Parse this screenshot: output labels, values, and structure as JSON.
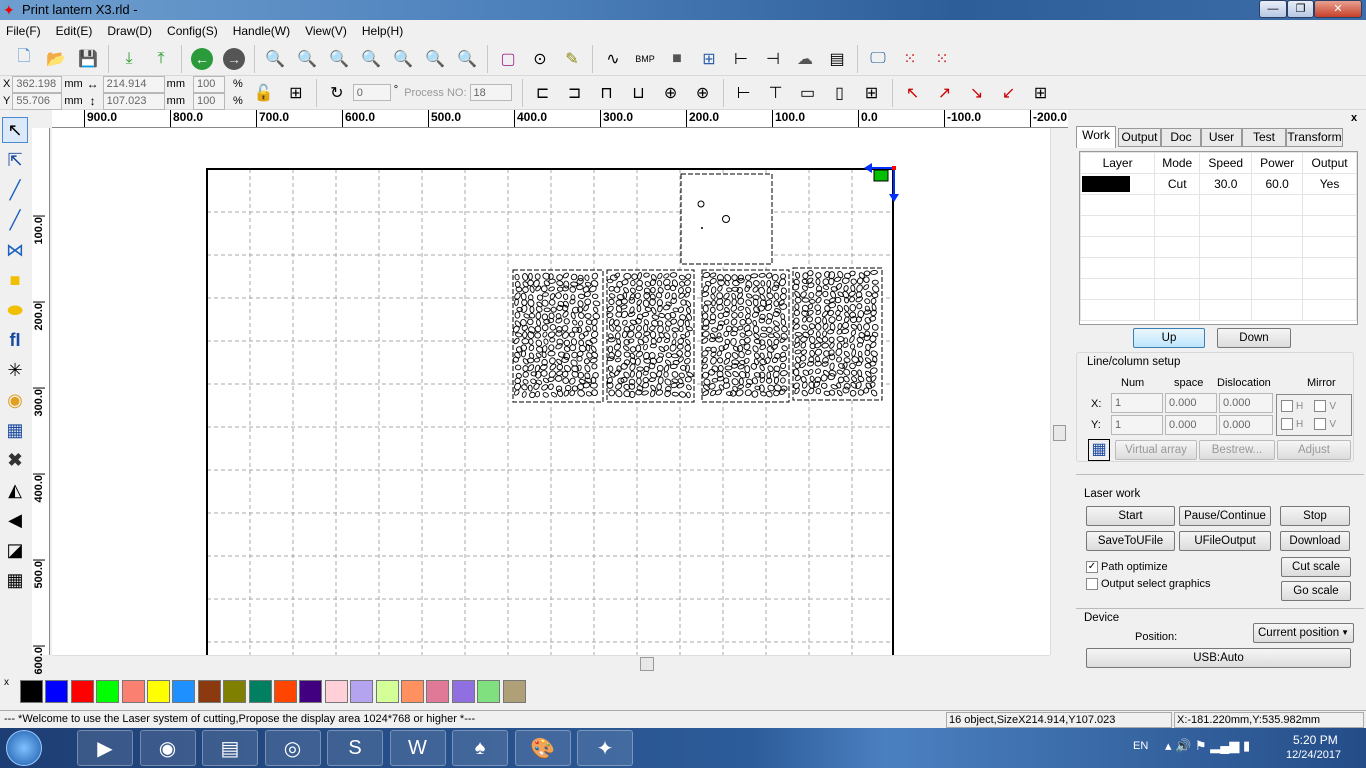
{
  "window": {
    "title": "Print lantern X3.rld -",
    "min": "—",
    "max": "❐",
    "close": "✕"
  },
  "menu": [
    "File(F)",
    "Edit(E)",
    "Draw(D)",
    "Config(S)",
    "Handle(W)",
    "View(V)",
    "Help(H)"
  ],
  "toolbar1": [
    "new-file",
    "open-folder",
    "save",
    "import",
    "export",
    "undo",
    "redo",
    "zoom-pan",
    "zoom-in",
    "zoom-out",
    "zoom-page",
    "zoom-select",
    "zoom-all",
    "zoom-fit",
    "select-rect",
    "node-edit",
    "magic",
    "polyline",
    "bmp",
    "fill-square",
    "group",
    "align-h",
    "align-v",
    "laser",
    "doc",
    "monitor",
    "grid-1",
    "grid-2"
  ],
  "coords": {
    "x_label": "X",
    "y_label": "Y",
    "x": "362.198",
    "y": "55.706",
    "w": "214.914",
    "h": "107.023",
    "unit": "mm",
    "sx": "100",
    "sy": "100",
    "pct": "%",
    "rotate": "0",
    "deg": "°",
    "process_label": "Process NO:",
    "process_no": "18"
  },
  "ruler": {
    "top": [
      "900.0",
      "800.0",
      "700.0",
      "600.0",
      "500.0",
      "400.0",
      "300.0",
      "200.0",
      "100.0",
      "0.0",
      "-100.0",
      "-200.0"
    ],
    "left": [
      "100.0",
      "200.0",
      "300.0",
      "400.0",
      "500.0",
      "600.0"
    ]
  },
  "palette": [
    "#000000",
    "#0000ff",
    "#ff0000",
    "#00ff00",
    "#fa8072",
    "#ffff00",
    "#1e90ff",
    "#8b3a10",
    "#808000",
    "#008060",
    "#ff4500",
    "#400080",
    "#ffd0d8",
    "#b4a4f0",
    "#d4ff98",
    "#ff9060",
    "#e07898",
    "#9070e0",
    "#80e080",
    "#b0a078"
  ],
  "palette_close": "x",
  "status": {
    "message": "--- *Welcome to use the Laser system of cutting,Propose the display area 1024*768 or higher *---",
    "objects": "16 object,SizeX214.914,Y107.023",
    "position": "X:-181.220mm,Y:535.982mm"
  },
  "panel": {
    "close": "x",
    "tabs": [
      "Work",
      "Output",
      "Doc",
      "User",
      "Test",
      "Transform"
    ],
    "layer_headers": [
      "Layer",
      "Mode",
      "Speed",
      "Power",
      "Output"
    ],
    "layers": [
      {
        "color": "#000000",
        "mode": "Cut",
        "speed": "30.0",
        "power": "60.0",
        "output": "Yes"
      }
    ],
    "up": "Up",
    "down": "Down",
    "lc": {
      "title": "Line/column setup",
      "num": "Num",
      "space": "space",
      "dislocation": "Dislocation",
      "mirror": "Mirror",
      "x_label": "X:",
      "y_label": "Y:",
      "x_num": "1",
      "x_space": "0.000",
      "x_disl": "0.000",
      "y_num": "1",
      "y_space": "0.000",
      "y_disl": "0.000",
      "h": "H",
      "v": "V",
      "virtual": "Virtual array",
      "bestrew": "Bestrew...",
      "adjust": "Adjust"
    },
    "laser": {
      "title": "Laser work",
      "start": "Start",
      "pause": "Pause/Continue",
      "stop": "Stop",
      "save": "SaveToUFile",
      "ufile": "UFileOutput",
      "download": "Download",
      "path_opt": "Path optimize",
      "path_opt_checked": true,
      "output_sel": "Output select graphics",
      "output_sel_checked": false,
      "cut_scale": "Cut scale",
      "go_scale": "Go scale"
    },
    "device": {
      "title": "Device",
      "position_label": "Position:",
      "position_value": "Current position",
      "usb": "USB:Auto"
    }
  },
  "taskbar": {
    "lang": "EN",
    "time": "5:20 PM",
    "date": "12/24/2017",
    "apps": [
      "media-player",
      "firefox",
      "file-explorer",
      "chrome",
      "skype",
      "word",
      "inkscape",
      "paint",
      "laser-app"
    ]
  }
}
